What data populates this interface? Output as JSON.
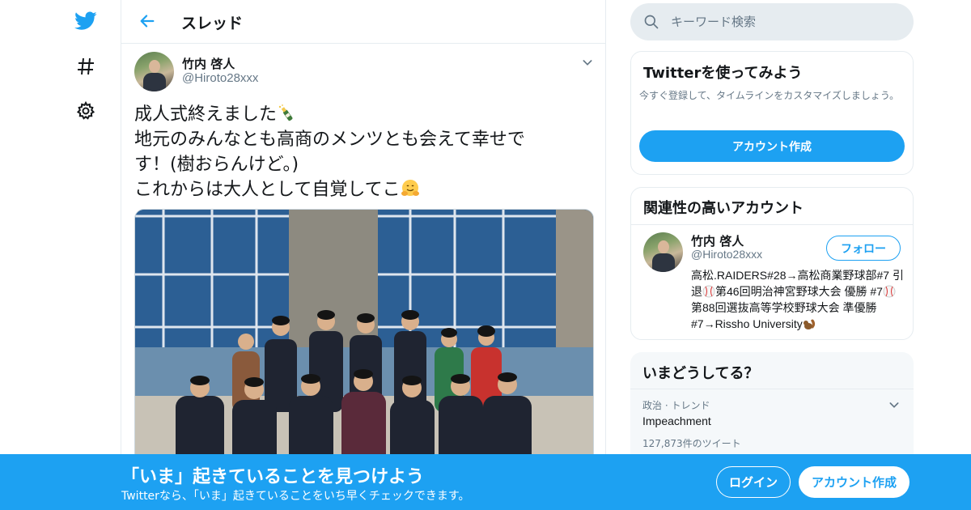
{
  "header": {
    "title": "スレッド"
  },
  "nav": {
    "icons": [
      "twitter-logo-icon",
      "hashtag-icon",
      "gear-icon"
    ]
  },
  "tweet": {
    "author_name": "竹内 啓人",
    "author_handle": "@Hiroto28xxx",
    "text_lines": [
      "成人式終えました",
      "地元のみんなとも高商のメンツとも会えて幸せで",
      "す！(樹おらんけど。)",
      "これからは大人として自覚してこ"
    ]
  },
  "search": {
    "placeholder": "キーワード検索"
  },
  "signup_card": {
    "title": "Twitterを使ってみよう",
    "description": "今すぐ登録して、タイムラインをカスタマイズしましょう。",
    "button": "アカウント作成"
  },
  "related": {
    "title": "関連性の高いアカウント",
    "name": "竹内 啓人",
    "handle": "@Hiroto28xxx",
    "follow_button": "フォロー",
    "bio_parts": [
      "高松.RAIDERS#28→高松商業野球部#7 引退",
      "第46回明治神宮野球大会 優勝 #7",
      "第88回選抜高等学校野球大会 準優勝 #7→Rissho University"
    ]
  },
  "trends": {
    "title": "いまどうしてる？",
    "items": [
      {
        "category": "政治 · トレンド",
        "name": "Impeachment",
        "count": "127,873件のツイート"
      }
    ]
  },
  "banner": {
    "title": "「いま」起きていることを見つけよう",
    "subtitle": "Twitterなら、「いま」起きていることをいち早くチェックできます。",
    "login": "ログイン",
    "signup": "アカウント作成"
  },
  "colors": {
    "brand": "#1da1f2",
    "text": "#14171a",
    "muted": "#657786",
    "border": "#e6ecf0"
  }
}
